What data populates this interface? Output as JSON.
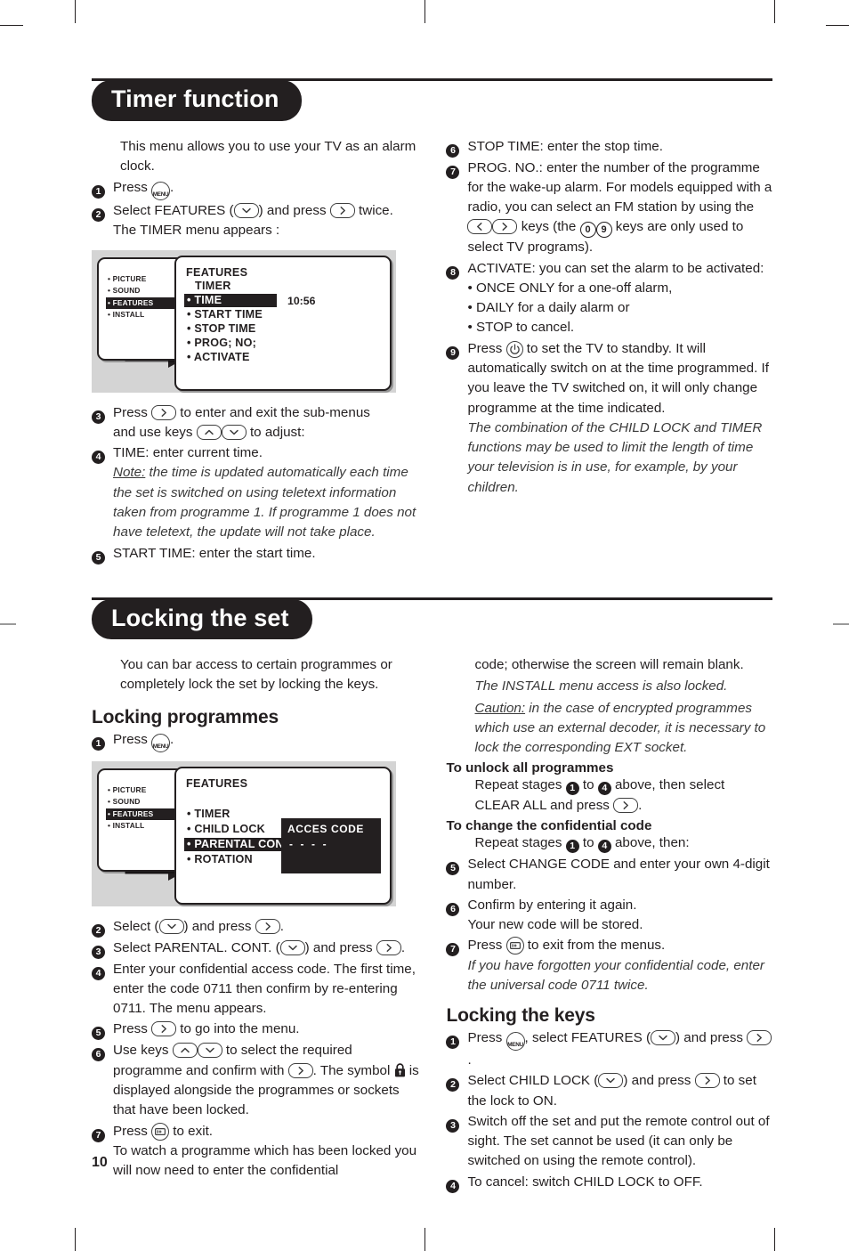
{
  "page": {
    "number": "10"
  },
  "sections": [
    {
      "id": "timer",
      "title": "Timer function",
      "intro": "This menu allows you to use your TV as an alarm clock.",
      "left_steps": [
        {
          "n": "1",
          "text_a": "Press ",
          "icon": "menu-key",
          "text_b": "."
        },
        {
          "n": "2",
          "text_a": "Select FEATURES (",
          "icon": "down-key",
          "text_b": ") and press ",
          "icon2": "right-key",
          "text_c": " twice.",
          "line2": "The TIMER menu appears :"
        }
      ],
      "figure": {
        "name": "features-timer-menu",
        "left_items": [
          {
            "label": "PICTURE",
            "highlight": false
          },
          {
            "label": "SOUND",
            "highlight": false
          },
          {
            "label": "FEATURES",
            "highlight": true
          },
          {
            "label": "INSTALL",
            "highlight": false
          }
        ],
        "title": "FEATURES",
        "subtitle": "TIMER",
        "rows": [
          {
            "label": "TIME",
            "highlight": true,
            "value": "10:56"
          },
          {
            "label": "START TIME",
            "highlight": false,
            "value": ""
          },
          {
            "label": "STOP TIME",
            "highlight": false,
            "value": ""
          },
          {
            "label": "PROG; NO;",
            "highlight": false,
            "value": ""
          },
          {
            "label": "ACTIVATE",
            "highlight": false,
            "value": ""
          }
        ]
      },
      "left_steps2": [
        {
          "n": "3",
          "a": "Press ",
          "b": " to enter and exit the sub-menus",
          "c": "and use keys ",
          "d": " to adjust:"
        },
        {
          "n": "4",
          "a": "TIME: enter current time.",
          "note_label": "Note:",
          "note": " the time is updated automatically each time the set is switched on using teletext information taken from programme 1. If programme 1 does not have teletext, the update will not take place."
        },
        {
          "n": "5",
          "a": "START TIME: enter the start time."
        }
      ],
      "right_steps": [
        {
          "n": "6",
          "text": "STOP TIME: enter the stop time."
        },
        {
          "n": "7",
          "a": "PROG. NO.: enter the number of the programme for the wake-up alarm. For models equipped with a radio, you can select an FM station by using the ",
          "b": " keys (the ",
          "c": " keys are only used to select TV programs)."
        },
        {
          "n": "8",
          "a": "ACTIVATE: you can set the alarm to be activated:",
          "bullets": [
            "• ONCE ONLY for a one-off alarm,",
            "• DAILY for a daily alarm or",
            "• STOP to cancel."
          ]
        },
        {
          "n": "9",
          "a": "Press ",
          "b": " to set the TV to standby. It will automatically switch on at the time programmed. If you leave the TV switched on, it will only change programme at the time indicated.",
          "note": "The combination of the CHILD LOCK and TIMER functions may be used to limit the length of time your television is in use, for example, by your children."
        }
      ]
    },
    {
      "id": "locking",
      "title": "Locking the set",
      "intro": "You can bar access to certain programmes or completely lock the set by locking the keys.",
      "subhead_programmes": "Locking programmes",
      "step1": {
        "n": "1",
        "a": "Press ",
        "b": "."
      },
      "figure": {
        "name": "features-childlock-menu",
        "left_items": [
          {
            "label": "PICTURE",
            "highlight": false
          },
          {
            "label": "SOUND",
            "highlight": false
          },
          {
            "label": "FEATURES",
            "highlight": true
          },
          {
            "label": "INSTALL",
            "highlight": false
          }
        ],
        "title": "FEATURES",
        "rows": [
          {
            "label": "TIMER",
            "highlight": false
          },
          {
            "label": "CHILD LOCK",
            "highlight": false
          },
          {
            "label": "PARENTAL CONT",
            "highlight": true
          },
          {
            "label": "ROTATION",
            "highlight": false
          }
        ],
        "code_title": "ACCES CODE",
        "code_value": "- - - -"
      },
      "left_steps": [
        {
          "n": "2",
          "a": "Select  (",
          "b": ") and press ",
          "c": "."
        },
        {
          "n": "3",
          "a": "Select PARENTAL. CONT. (",
          "b": ") and press ",
          "c": "."
        },
        {
          "n": "4",
          "a": "Enter your confidential access code. The first time, enter the code 0711 then confirm by re-entering 0711. The menu appears."
        },
        {
          "n": "5",
          "a": "Press ",
          "b": " to go into the menu."
        },
        {
          "n": "6",
          "a": "Use keys ",
          "b": " to select the required programme and confirm with ",
          "c": ". The symbol ",
          "d": " is displayed alongside the programmes or sockets that have been locked."
        },
        {
          "n": "7",
          "a": "Press ",
          "b": " to exit.",
          "line2": "To watch a programme which has been locked you will now need to enter the confidential"
        }
      ],
      "right_col": {
        "cont": "code; otherwise the screen will remain blank.",
        "italic1": "The INSTALL menu access is also locked.",
        "caution_label": "Caution:",
        "caution": " in the case of encrypted programmes which use an external decoder, it is necessary to lock the corresponding EXT socket.",
        "unlock_head": "To unlock all programmes",
        "unlock_a": "Repeat stages ",
        "unlock_b": " to ",
        "unlock_c": " above, then select CLEAR ALL and press ",
        "unlock_d": ".",
        "change_head": "To change the confidential code",
        "change_a": "Repeat stages ",
        "change_b": " to ",
        "change_c": " above, then:",
        "steps": [
          {
            "n": "5",
            "text": "Select CHANGE CODE and enter your own 4-digit number."
          },
          {
            "n": "6",
            "text": "Confirm by entering it again.",
            "line2": "Your new code will be stored."
          },
          {
            "n": "7",
            "a": "Press ",
            "b": " to exit from the menus.",
            "note": "If you have forgotten your confidential code, enter the universal code 0711 twice."
          }
        ],
        "keys_head": "Locking the keys",
        "keys_steps": [
          {
            "n": "1",
            "a": "Press ",
            "b": ", select FEATURES (",
            "c": ") and press ",
            "d": "."
          },
          {
            "n": "2",
            "a": "Select CHILD LOCK (",
            "b": ") and press ",
            "c": " to set the lock to ON."
          },
          {
            "n": "3",
            "a": "Switch off the set and put the remote control out of sight. The set cannot be used (it can only be switched on using the remote control)."
          },
          {
            "n": "4",
            "a": "To cancel: switch CHILD LOCK to OFF."
          }
        ]
      }
    }
  ],
  "icons": {
    "menu_label": "MENU",
    "exit_label": "i+",
    "zero": "0",
    "nine": "9"
  },
  "colors": {
    "ink": "#231f20",
    "figure_bg": "#d4d4d4",
    "highlight": "#231f20"
  }
}
